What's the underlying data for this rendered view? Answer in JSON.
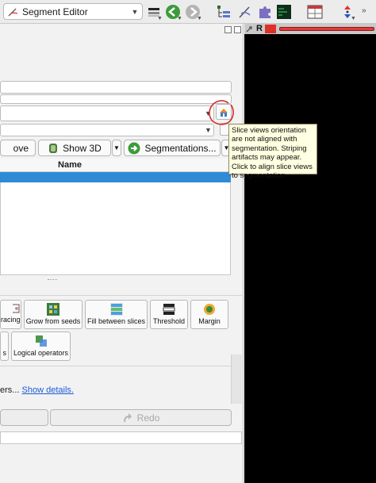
{
  "toolbar": {
    "module_select_value": "Segment Editor"
  },
  "slice_view": {
    "name": "R",
    "color": "#e0302a"
  },
  "controls": {
    "show3d_label": "Show 3D",
    "segmentations_label": "Segmentations...",
    "remove_partial": "ove",
    "name_column": "Name"
  },
  "effects": {
    "row1": [
      "racing",
      "Grow from seeds",
      "Fill between slices",
      "Threshold",
      "Margin"
    ],
    "row2": [
      "s",
      "Logical operators"
    ]
  },
  "status": {
    "partial_text": "ers... ",
    "show_details_link": "Show details."
  },
  "history": {
    "redo_label": "Redo"
  },
  "tooltip": {
    "text": "Slice views orientation are not aligned with segmentation. Striping artifacts may appear. Click to align slice views to segmentation."
  },
  "colors": {
    "selection": "#2f8bd6",
    "tooltip_bg": "#ffffe1",
    "annotation_circle": "#d62c2c",
    "link": "#1d5bd6"
  }
}
